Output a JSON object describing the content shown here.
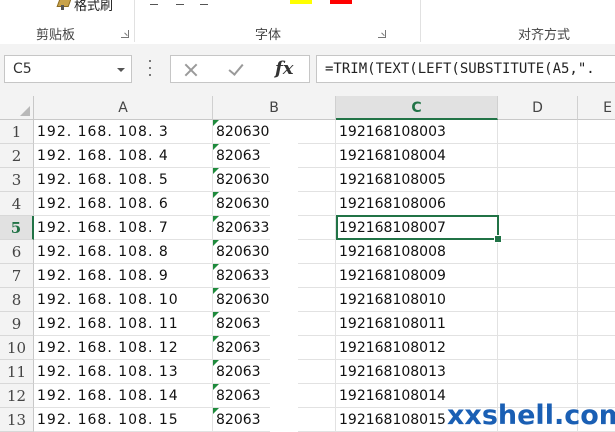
{
  "ribbon": {
    "clipboard": {
      "label": "剪贴板",
      "format_painter": "格式刷"
    },
    "font": {
      "label": "字体",
      "highlight_color": "#FFFF00",
      "font_color": "#FF0000"
    },
    "alignment": {
      "label": "对齐方式"
    }
  },
  "formula_bar": {
    "name_box": "C5",
    "fx_label": "fx",
    "formula": "=TRIM(TEXT(LEFT(SUBSTITUTE(A5,\"."
  },
  "grid": {
    "columns": [
      "A",
      "B",
      "C",
      "D",
      "E"
    ],
    "active_column": "C",
    "active_row": 5,
    "rows": [
      {
        "n": "1",
        "a": "192. 168. 108. 3",
        "b": "820630",
        "c": "192168108003"
      },
      {
        "n": "2",
        "a": "192. 168. 108. 4",
        "b": "82063",
        "c": "192168108004"
      },
      {
        "n": "3",
        "a": "192. 168. 108. 5",
        "b": "820630",
        "c": "192168108005"
      },
      {
        "n": "4",
        "a": "192. 168. 108. 6",
        "b": "820630",
        "c": "192168108006"
      },
      {
        "n": "5",
        "a": "192. 168. 108. 7",
        "b": "820633",
        "c": "192168108007"
      },
      {
        "n": "6",
        "a": "192. 168. 108. 8",
        "b": "820630",
        "c": "192168108008"
      },
      {
        "n": "7",
        "a": "192. 168. 108. 9",
        "b": "820633",
        "c": "192168108009"
      },
      {
        "n": "8",
        "a": "192. 168. 108. 10",
        "b": "820630",
        "c": "192168108010"
      },
      {
        "n": "9",
        "a": "192. 168. 108. 11",
        "b": "82063",
        "c": "192168108011"
      },
      {
        "n": "10",
        "a": "192. 168. 108. 12",
        "b": "82063",
        "c": "192168108012"
      },
      {
        "n": "11",
        "a": "192. 168. 108. 13",
        "b": "82063",
        "c": "192168108013"
      },
      {
        "n": "12",
        "a": "192. 168. 108. 14",
        "b": "82063",
        "c": "192168108014"
      },
      {
        "n": "13",
        "a": "192. 168. 108. 15",
        "b": "82063",
        "c": "192168108015"
      }
    ]
  },
  "watermark": "xxshell.com",
  "colors": {
    "accent": "#217346",
    "error_marker": "#1e8a3c",
    "watermark": "#1a5fb4"
  }
}
